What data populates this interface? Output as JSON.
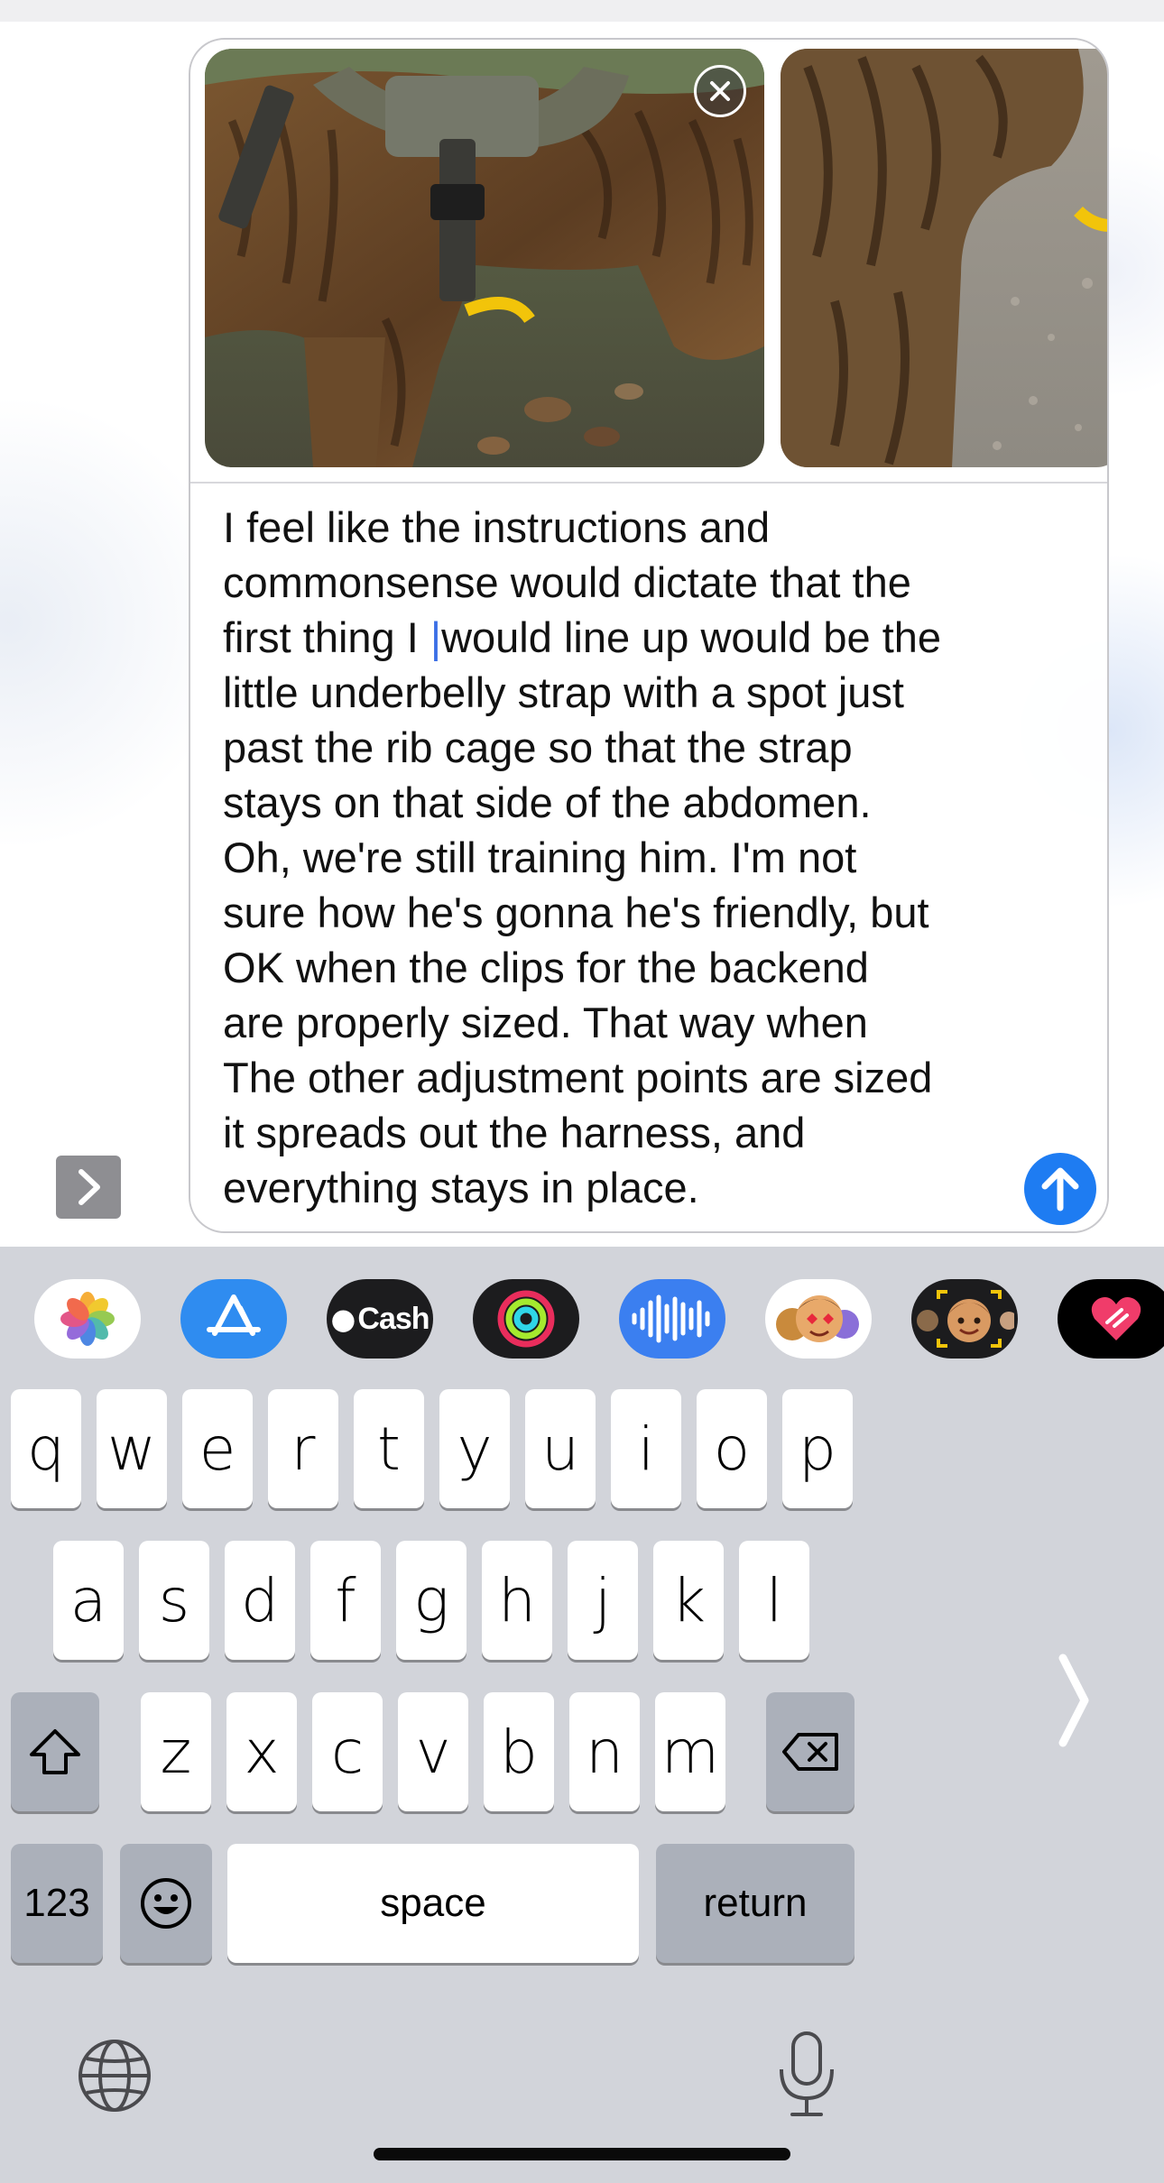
{
  "compose": {
    "attachments": [
      {
        "name": "dog-harness-photo-1",
        "removable": true
      },
      {
        "name": "dog-harness-photo-2",
        "removable": false
      }
    ],
    "text_before_cursor": "I feel like the instructions and\ncommonsense would dictate that the\nfirst thing I ",
    "text_after_cursor": "would line up would be the\nlittle underbelly strap with a spot just\npast the rib cage so that the strap\nstays on that side of the abdomen.\nOh, we're still training him. I'm not\nsure how he's gonna he's friendly, but\nOK when the clips for the backend\nare properly sized. That way when\nThe other adjustment points are sized\nit spreads out the harness, and\neverything stays in place.",
    "send_icon": "arrow-up-icon",
    "accent_color": "#1e7cf2"
  },
  "apps_toggle": {
    "icon": "chevron-right-icon"
  },
  "app_strip": {
    "apps": [
      {
        "name": "photos",
        "label": ""
      },
      {
        "name": "app-store",
        "label": ""
      },
      {
        "name": "cash",
        "label": "Cash"
      },
      {
        "name": "activity",
        "label": ""
      },
      {
        "name": "audio",
        "label": ""
      },
      {
        "name": "memoji-stickers",
        "label": ""
      },
      {
        "name": "memoji",
        "label": ""
      },
      {
        "name": "digital-touch",
        "label": ""
      }
    ]
  },
  "keyboard": {
    "row1": [
      "q",
      "w",
      "e",
      "r",
      "t",
      "y",
      "u",
      "i",
      "o",
      "p"
    ],
    "row2": [
      "a",
      "s",
      "d",
      "f",
      "g",
      "h",
      "j",
      "k",
      "l"
    ],
    "row3": [
      "z",
      "x",
      "c",
      "v",
      "b",
      "n",
      "m"
    ],
    "numbers_label": "123",
    "space_label": "space",
    "return_label": "return",
    "shift_icon": "shift-icon",
    "delete_icon": "delete-icon",
    "emoji_icon": "emoji-icon",
    "globe_icon": "globe-icon",
    "mic_icon": "microphone-icon"
  }
}
